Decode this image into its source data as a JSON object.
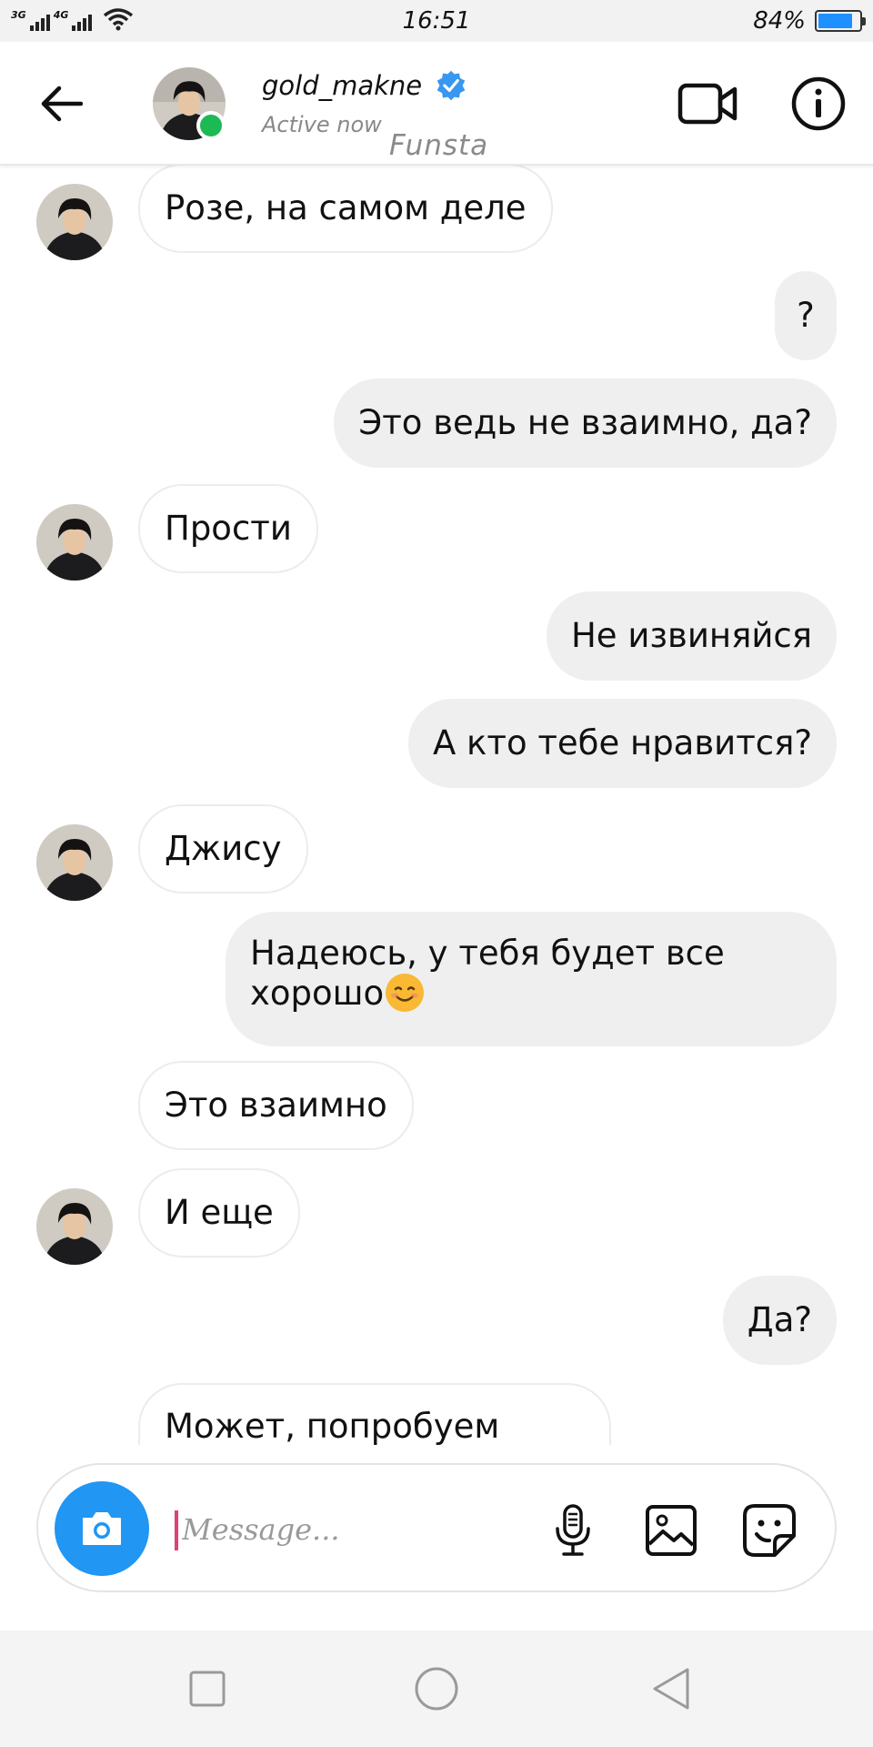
{
  "status_bar": {
    "network_1": "3G",
    "network_2": "4G",
    "time": "16:51",
    "battery_text": "84%",
    "battery_level": 0.84,
    "battery_color": "#1e90ff"
  },
  "header": {
    "back_icon": "arrow-left-icon",
    "username": "gold_makne",
    "verified_icon": "verified-badge-icon",
    "status": "Active now",
    "watermark": "Funsta",
    "video_icon": "video-camera-icon",
    "info_icon": "info-icon",
    "online_color": "#1db954"
  },
  "messages": [
    {
      "from": "them",
      "text": "Розе, на самом деле"
    },
    {
      "from": "me",
      "text": "?"
    },
    {
      "from": "me",
      "text": "Это ведь не взаимно, да?"
    },
    {
      "from": "them",
      "text": "Прости"
    },
    {
      "from": "me",
      "text": "Не извиняйся"
    },
    {
      "from": "me",
      "text": "А кто тебе нравится?"
    },
    {
      "from": "them",
      "text": "Джису"
    },
    {
      "from": "me",
      "text_line1": "Надеюсь, у тебя будет все",
      "text_line2": "хорошо",
      "emoji": "smiling-face-emoji"
    },
    {
      "from": "them",
      "text": "Это взаимно"
    },
    {
      "from": "them",
      "text": "И еще"
    },
    {
      "from": "me",
      "text": "Да?"
    },
    {
      "from": "them",
      "text": "Может, попробуем"
    }
  ],
  "composer": {
    "camera_icon": "camera-icon",
    "placeholder": "Message...",
    "mic_icon": "microphone-icon",
    "gallery_icon": "image-icon",
    "sticker_icon": "sticker-icon",
    "accent": "#2196f3",
    "caret_color": "#e0407a"
  },
  "navbar": {
    "recents_icon": "square-icon",
    "home_icon": "circle-icon",
    "back_icon": "triangle-back-icon"
  }
}
